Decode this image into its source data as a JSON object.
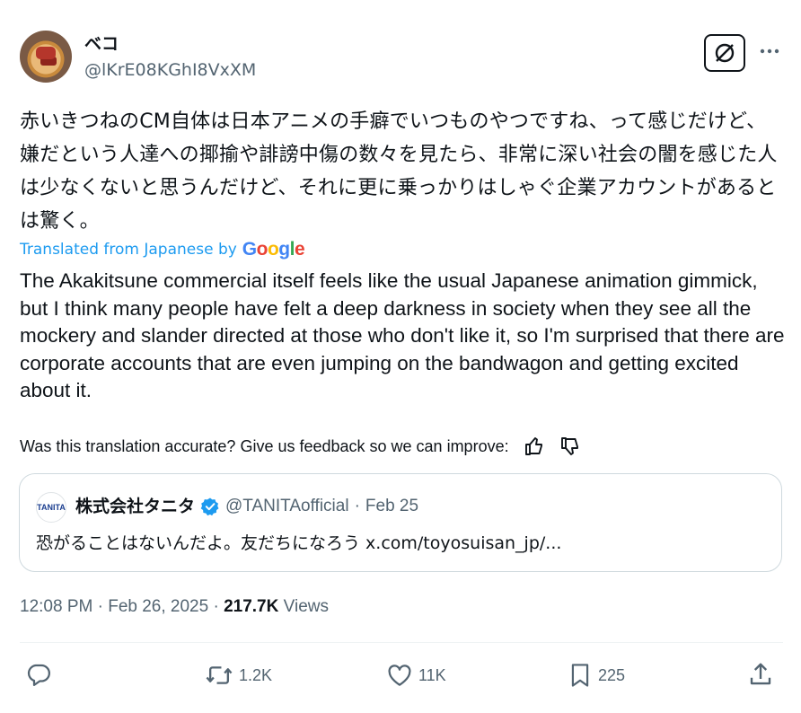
{
  "tweet": {
    "author": {
      "display_name": "ベコ",
      "handle": "@lKrE08KGhI8VxXM"
    },
    "original_text": "赤いきつねのCM自体は日本アニメの手癖でいつものやつですね、って感じだけど、嫌だという人達への揶揄や誹謗中傷の数々を見たら、非常に深い社会の闇を感じた人は少なくないと思うんだけど、それに更に乗っかりはしゃぐ企業アカウントがあるとは驚く。",
    "translated_label": "Translated from Japanese by",
    "translation_provider": "Google",
    "translated_text": "The Akakitsune commercial itself feels like the usual Japanese animation gimmick, but I think many people have felt a deep darkness in society when they see all the mockery and slander directed at those who don't like it, so I'm surprised that there are corporate accounts that are even jumping on the bandwagon and getting excited about it.",
    "feedback_prompt": "Was this translation accurate? Give us feedback so we can improve:",
    "quote": {
      "avatar_text": "TANITA",
      "display_name": "株式会社タニタ",
      "handle": "@TANITAofficial",
      "separator": "·",
      "date": "Feb 25",
      "text": "恐がることはないんだよ。友だちになろう x.com/toyosuisan_jp/..."
    },
    "timestamp": "12:08 PM · Feb 26, 2025 · ",
    "views_count": "217.7K",
    "views_label": " Views",
    "actions": {
      "reposts": "1.2K",
      "likes": "11K",
      "bookmarks": "225"
    }
  },
  "colors": {
    "link_blue": "#1d9bf0",
    "secondary_text": "#536471",
    "primary_text": "#0f1419",
    "border": "#cfd9de"
  },
  "icons": [
    "grok-icon",
    "more-icon",
    "thumbs-up-icon",
    "thumbs-down-icon",
    "verified-badge-icon",
    "reply-icon",
    "repost-icon",
    "like-icon",
    "bookmark-icon",
    "share-icon"
  ]
}
